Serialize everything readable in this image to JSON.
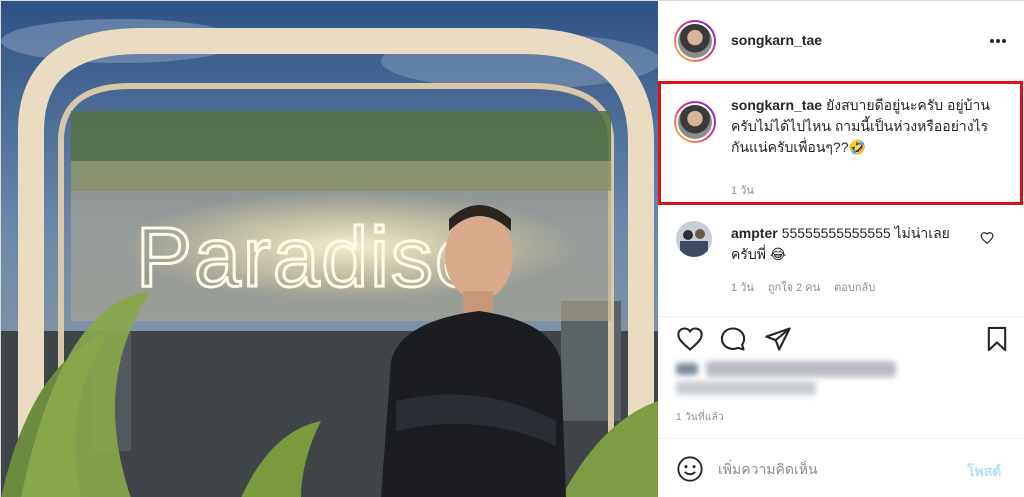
{
  "photo": {
    "sign_text": "Paradise"
  },
  "header": {
    "username": "songkarn_tae",
    "more_icon": "more-horizontal-icon"
  },
  "caption": {
    "username": "songkarn_tae",
    "text": "ยังสบายดีอยู่นะครับ อยู่บ้านครับไม่ได้ไปไหน ถามนี้เป็นห่วงหรืออย่างไรกันแน่ครับเพื่อนๆ??🤣",
    "time": "1 วัน"
  },
  "comment": {
    "username": "ampter",
    "text": "55555555555555 ไม่น่าเลยครับพี่ 😂",
    "time": "1 วัน",
    "likes": "ถูกใจ 2 คน",
    "reply": "ตอบกลับ"
  },
  "post_time": "1 วันที่แล้ว",
  "add_comment": {
    "placeholder": "เพิ่มความคิดเห็น",
    "post_label": "โพสต์"
  },
  "colors": {
    "highlight": "#e0101a",
    "post_button": "#b2dffc"
  }
}
